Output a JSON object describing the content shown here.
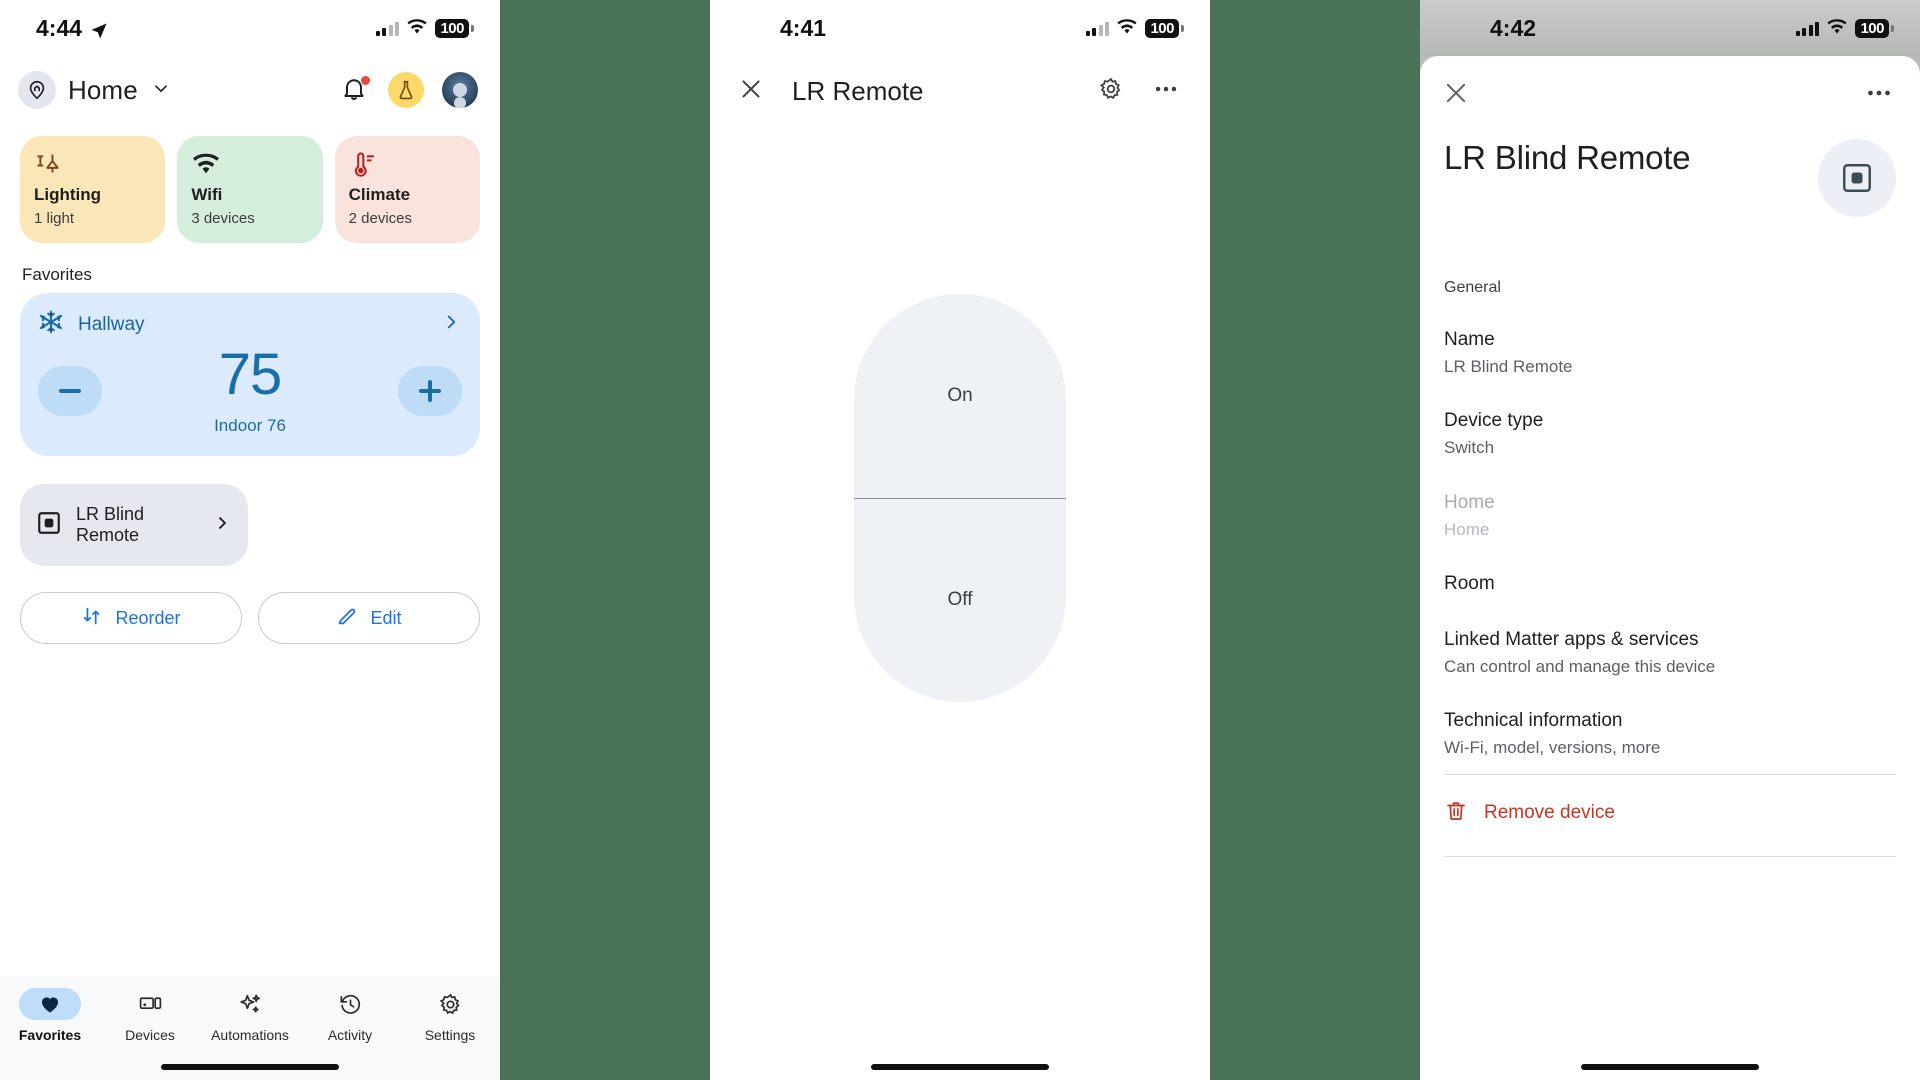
{
  "panels": {
    "favorites": {
      "status": {
        "time": "4:44",
        "battery": "100",
        "location_icon": "location-arrow-icon"
      },
      "header": {
        "title": "Home",
        "pin_icon": "location-pin-icon",
        "chevron_icon": "chevron-down-icon",
        "bell_icon": "notification-bell-icon",
        "flask_icon": "experiments-flask-icon",
        "avatar_icon": "user-avatar"
      },
      "chips": [
        {
          "name": "Lighting",
          "sub": "1 light",
          "icon": "lamp-icon",
          "bg": "#fbe6b8",
          "fg": "#7a4a1a"
        },
        {
          "name": "Wifi",
          "sub": "3 devices",
          "icon": "wifi-icon",
          "bg": "#d4eedb",
          "fg": "#1f1f1f"
        },
        {
          "name": "Climate",
          "sub": "2 devices",
          "icon": "thermometer-icon",
          "bg": "#fae2dd",
          "fg": "#b3261e"
        }
      ],
      "section_label": "Favorites",
      "thermostat": {
        "room": "Hallway",
        "mode_icon": "snowflake-icon",
        "chevron_icon": "chevron-right-icon",
        "setpoint": "75",
        "indoor": "Indoor 76",
        "minus_label": "decrease-temperature",
        "plus_label": "increase-temperature",
        "accent": "#1a6ea8"
      },
      "device": {
        "name": "LR Blind Remote",
        "icon": "blind-remote-icon",
        "chevron_icon": "chevron-right-icon"
      },
      "actions": [
        {
          "label": "Reorder",
          "icon": "reorder-arrows-icon"
        },
        {
          "label": "Edit",
          "icon": "pencil-edit-icon"
        }
      ],
      "nav": [
        {
          "label": "Favorites",
          "icon": "heart-icon",
          "active": true
        },
        {
          "label": "Devices",
          "icon": "devices-icon",
          "active": false
        },
        {
          "label": "Automations",
          "icon": "sparkles-icon",
          "active": false
        },
        {
          "label": "Activity",
          "icon": "history-icon",
          "active": false
        },
        {
          "label": "Settings",
          "icon": "gear-icon",
          "active": false
        }
      ]
    },
    "remote": {
      "status": {
        "time": "4:41",
        "battery": "100"
      },
      "header": {
        "close_icon": "close-x-icon",
        "title": "LR Remote",
        "settings_icon": "gear-icon",
        "overflow_icon": "more-horizontal-icon"
      },
      "toggle": {
        "on_label": "On",
        "off_label": "Off",
        "state": "off"
      }
    },
    "settings": {
      "status": {
        "time": "4:42",
        "battery": "100"
      },
      "sheet": {
        "close_icon": "close-x-icon",
        "overflow_icon": "more-horizontal-icon",
        "title": "LR Blind Remote",
        "hero_icon": "blind-remote-icon",
        "group_label": "General",
        "rows": [
          {
            "title": "Name",
            "sub": "LR Blind Remote",
            "muted": false
          },
          {
            "title": "Device type",
            "sub": "Switch",
            "muted": false
          },
          {
            "title": "Home",
            "sub": "Home",
            "muted": true
          },
          {
            "title": "Room",
            "sub": "",
            "muted": false
          },
          {
            "title": "Linked Matter apps & services",
            "sub": "Can control and manage this device",
            "muted": false
          },
          {
            "title": "Technical information",
            "sub": "Wi-Fi, model, versions, more",
            "muted": false
          }
        ],
        "remove": {
          "label": "Remove device",
          "icon": "trash-icon",
          "color": "#c5341f"
        }
      }
    }
  },
  "background_color": "#4a7355"
}
